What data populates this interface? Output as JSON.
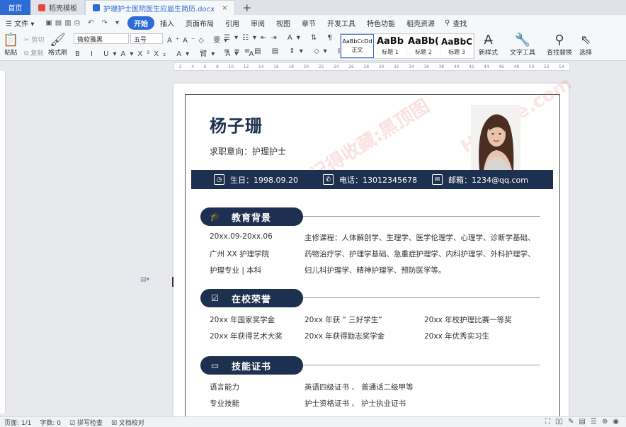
{
  "tabs": {
    "home": "首页",
    "templates": "稻壳模板",
    "doc": "护理护士医院医生应届生简历.docx",
    "close": "×",
    "add": "+"
  },
  "menu": {
    "file": "文件",
    "items": [
      "开始",
      "插入",
      "页面布局",
      "引用",
      "审阅",
      "视图",
      "章节",
      "开发工具",
      "特色功能",
      "稻壳资源"
    ],
    "search": "查找"
  },
  "ribbon": {
    "paste": "粘贴",
    "cut": "剪切",
    "copy": "复制",
    "format_painter": "格式刷",
    "font_name": "微软雅黑",
    "font_size": "五号",
    "styles": [
      {
        "preview": "AaBbCcDd",
        "label": "正文"
      },
      {
        "preview": "AaBb",
        "label": "标题 1"
      },
      {
        "preview": "AaBb(",
        "label": "标题 2"
      },
      {
        "preview": "AaBbC",
        "label": "标题 3"
      }
    ],
    "new_style": "新样式",
    "text_tools": "文字工具",
    "find_replace": "查找替换",
    "select": "选择"
  },
  "ruler_ticks": [
    "2",
    "4",
    "6",
    "8",
    "10",
    "12",
    "14",
    "16",
    "18",
    "20",
    "22",
    "24",
    "26",
    "28",
    "30",
    "32",
    "34",
    "36",
    "38",
    "40",
    "42",
    "44",
    "46",
    "48",
    "50",
    "52",
    "54"
  ],
  "resume": {
    "name": "杨子珊",
    "objective": "求职意向：护理护士",
    "birthday": "生日：1998.09.20",
    "phone": "电话：13012345678",
    "email": "邮箱：1234@qq.com",
    "watermark1": "记得收藏:黑顶图",
    "watermark2": "Hybase.com",
    "edu": {
      "title": "教育背景",
      "period": "20xx.09-20xx.06",
      "school": "广州 XX 护理学院",
      "major": "护理专业 | 本科",
      "courses1": "主修课程：人体解剖学、生理学、医学伦理学、心理学、诊断学基础、",
      "courses2": "药物治疗学、护理学基础、急重症护理学、内科护理学、外科护理学、",
      "courses3": "妇儿科护理学、精神护理学、预防医学等。"
    },
    "honors": {
      "title": "在校荣誉",
      "a1": "20xx 年国家奖学金",
      "a2": "20xx 年获 “ 三好学生”",
      "a3": "20xx 年校护理比赛一等奖",
      "b1": "20xx 年获得艺术大奖",
      "b2": "20xx 年获得励志奖学金",
      "b3": "20xx 年优秀实习生"
    },
    "skills": {
      "title": "技能证书",
      "lang_label": "语言能力",
      "lang_value": "英语四级证书 、 普通话二级甲等",
      "pro_label": "专业技能",
      "pro_value": "护士资格证书 、 护士执业证书"
    }
  },
  "status": {
    "page": "页面: 1/1",
    "words": "字数: 0",
    "spell": "拼写检查",
    "proof": "文档校对"
  },
  "colors": {
    "navy": "#1e3050",
    "accent": "#2d6bd6"
  }
}
